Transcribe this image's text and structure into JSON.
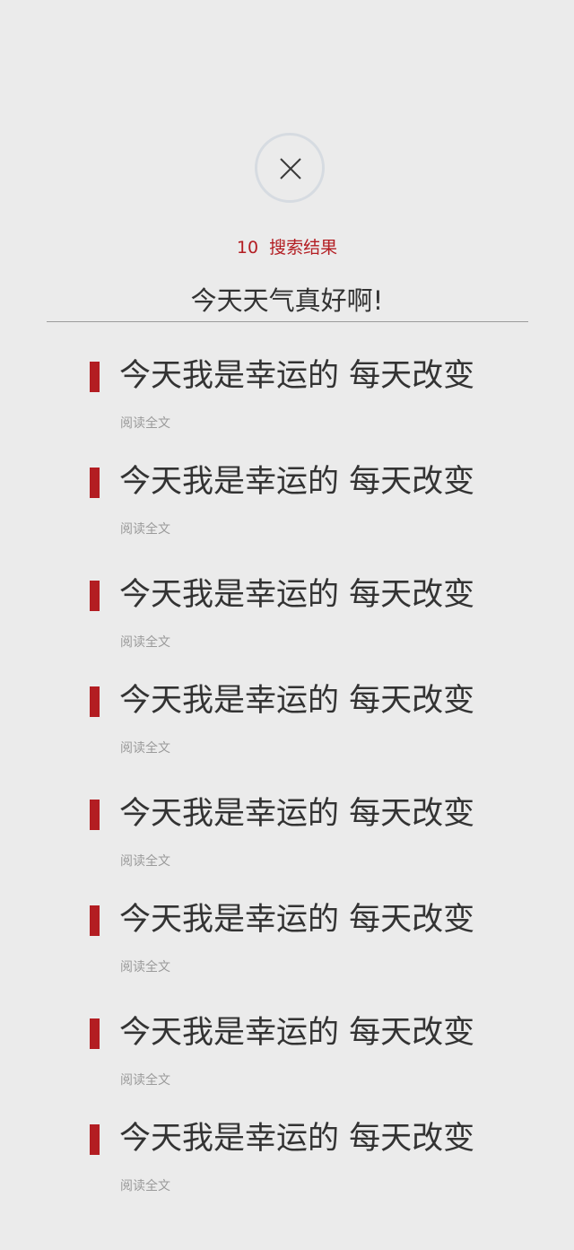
{
  "header": {
    "close_icon": "close-icon"
  },
  "search": {
    "count": "10",
    "count_label": "搜索结果",
    "query": "今天天气真好啊!"
  },
  "colors": {
    "accent": "#b31d22",
    "background": "#ebebeb",
    "text": "#333333",
    "muted": "#9a9a9a"
  },
  "results": [
    {
      "title": "今天我是幸运的 每天改变",
      "read_more": "阅读全文"
    },
    {
      "title": "今天我是幸运的 每天改变",
      "read_more": "阅读全文"
    },
    {
      "title": "今天我是幸运的 每天改变",
      "read_more": "阅读全文"
    },
    {
      "title": "今天我是幸运的 每天改变",
      "read_more": "阅读全文"
    },
    {
      "title": "今天我是幸运的 每天改变",
      "read_more": "阅读全文"
    },
    {
      "title": "今天我是幸运的 每天改变",
      "read_more": "阅读全文"
    },
    {
      "title": "今天我是幸运的 每天改变",
      "read_more": "阅读全文"
    },
    {
      "title": "今天我是幸运的 每天改变",
      "read_more": "阅读全文"
    }
  ]
}
